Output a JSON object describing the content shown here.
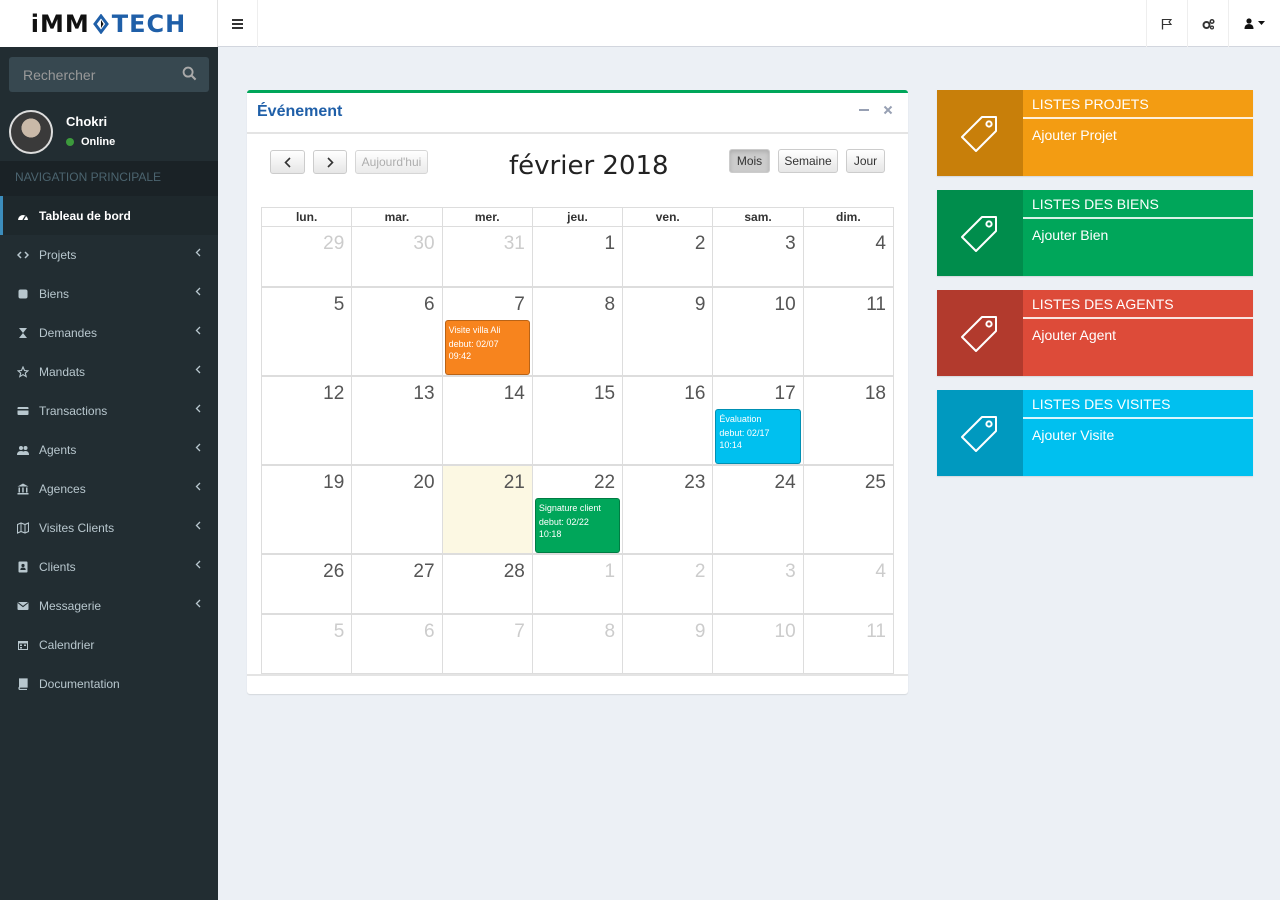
{
  "brand": {
    "part1": "iMM",
    "part2": "TECH"
  },
  "sidebar": {
    "search_placeholder": "Rechercher",
    "user": {
      "name": "Chokri",
      "status": "Online"
    },
    "nav_header": "NAVIGATION PRINCIPALE",
    "items": [
      {
        "label": "Tableau de bord",
        "icon": "dashboard-icon",
        "has_children": false
      },
      {
        "label": "Projets",
        "icon": "code-icon",
        "has_children": true
      },
      {
        "label": "Biens",
        "icon": "square-icon",
        "has_children": true
      },
      {
        "label": "Demandes",
        "icon": "hourglass-icon",
        "has_children": true
      },
      {
        "label": "Mandats",
        "icon": "star-icon",
        "has_children": true
      },
      {
        "label": "Transactions",
        "icon": "credit-card-icon",
        "has_children": true
      },
      {
        "label": "Agents",
        "icon": "users-icon",
        "has_children": true
      },
      {
        "label": "Agences",
        "icon": "bank-icon",
        "has_children": true
      },
      {
        "label": "Visites Clients",
        "icon": "map-icon",
        "has_children": true
      },
      {
        "label": "Clients",
        "icon": "address-book-icon",
        "has_children": true
      },
      {
        "label": "Messagerie",
        "icon": "envelope-icon",
        "has_children": true
      },
      {
        "label": "Calendrier",
        "icon": "calendar-icon",
        "has_children": false
      },
      {
        "label": "Documentation",
        "icon": "book-icon",
        "has_children": false
      }
    ]
  },
  "calendar_box": {
    "title": "Événement",
    "buttons": {
      "today": "Aujourd'hui",
      "month": "Mois",
      "week": "Semaine",
      "day": "Jour"
    },
    "month_title": "février 2018",
    "weekdays": [
      "lun.",
      "mar.",
      "mer.",
      "jeu.",
      "ven.",
      "sam.",
      "dim."
    ],
    "weeks": [
      [
        {
          "n": "29",
          "o": true
        },
        {
          "n": "30",
          "o": true
        },
        {
          "n": "31",
          "o": true
        },
        {
          "n": "1"
        },
        {
          "n": "2"
        },
        {
          "n": "3"
        },
        {
          "n": "4"
        }
      ],
      [
        {
          "n": "5"
        },
        {
          "n": "6"
        },
        {
          "n": "7",
          "event": 0
        },
        {
          "n": "8"
        },
        {
          "n": "9"
        },
        {
          "n": "10"
        },
        {
          "n": "11"
        }
      ],
      [
        {
          "n": "12"
        },
        {
          "n": "13"
        },
        {
          "n": "14"
        },
        {
          "n": "15"
        },
        {
          "n": "16"
        },
        {
          "n": "17",
          "event": 1
        },
        {
          "n": "18"
        }
      ],
      [
        {
          "n": "19"
        },
        {
          "n": "20"
        },
        {
          "n": "21",
          "today": true
        },
        {
          "n": "22",
          "event": 2
        },
        {
          "n": "23"
        },
        {
          "n": "24"
        },
        {
          "n": "25"
        }
      ],
      [
        {
          "n": "26"
        },
        {
          "n": "27"
        },
        {
          "n": "28"
        },
        {
          "n": "1",
          "o": true
        },
        {
          "n": "2",
          "o": true
        },
        {
          "n": "3",
          "o": true
        },
        {
          "n": "4",
          "o": true
        }
      ],
      [
        {
          "n": "5",
          "o": true
        },
        {
          "n": "6",
          "o": true
        },
        {
          "n": "7",
          "o": true
        },
        {
          "n": "8",
          "o": true
        },
        {
          "n": "9",
          "o": true
        },
        {
          "n": "10",
          "o": true
        },
        {
          "n": "11",
          "o": true
        }
      ]
    ],
    "events": [
      {
        "title": "Visite villa Ali",
        "start": "debut: 02/07",
        "time": "09:42",
        "color": "#f7841e"
      },
      {
        "title": "Évaluation",
        "start": "debut: 02/17",
        "time": "10:14",
        "color": "#00c0ef"
      },
      {
        "title": "Signature client",
        "start": "debut: 02/22",
        "time": "10:18",
        "color": "#00a65a"
      }
    ]
  },
  "info_boxes": [
    {
      "title": "LISTES PROJETS",
      "link": "Ajouter Projet",
      "color": "#f39c12",
      "icon_bg": "#c87f0a"
    },
    {
      "title": "LISTES DES BIENS",
      "link": "Ajouter Bien",
      "color": "#00a65a",
      "icon_bg": "#008d4c"
    },
    {
      "title": "LISTES DES AGENTS",
      "link": "Ajouter Agent",
      "color": "#dd4b39",
      "icon_bg": "#b23a2d"
    },
    {
      "title": "LISTES DES VISITES",
      "link": "Ajouter Visite",
      "color": "#00c0ef",
      "icon_bg": "#0099bf"
    }
  ]
}
